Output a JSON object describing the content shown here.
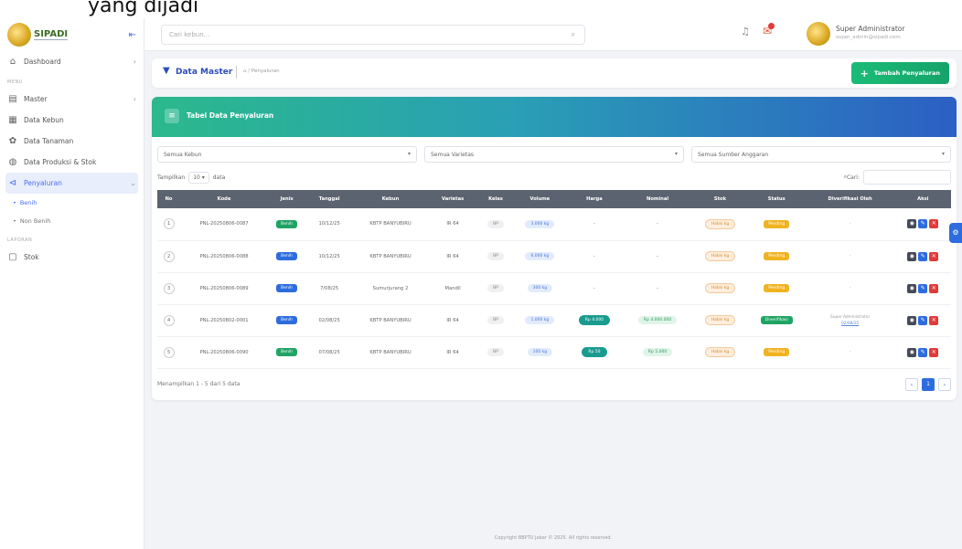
{
  "caption": "yang dijadi",
  "brand": {
    "name": "SIPADI",
    "toggle": "⇤"
  },
  "sidebar": {
    "items": [
      {
        "icon": "⌂",
        "label": "Dashboard",
        "chevron": "›"
      },
      {
        "section": "MENU"
      },
      {
        "icon": "▤",
        "label": "Master",
        "chevron": "›"
      },
      {
        "icon": "▦",
        "label": "Data Kebun"
      },
      {
        "icon": "✿",
        "label": "Data Tanaman"
      },
      {
        "icon": "◍",
        "label": "Data Produksi & Stok"
      },
      {
        "icon": "⊲",
        "label": "Penyaluran",
        "chevron": "⌄",
        "active": true
      }
    ],
    "subs": [
      "Benih",
      "Non Benih"
    ],
    "section2": "LAPORAN",
    "report": {
      "icon": "▢",
      "label": "Stok"
    }
  },
  "topbar": {
    "search_placeholder": "Cari kebun...",
    "user_name": "Super Administrator",
    "user_email": "super_admin@sipadi.com"
  },
  "page": {
    "title": "Data Master",
    "crumb": "⌂ / Penyaluran",
    "add_button": "Tambah Penyaluran"
  },
  "card": {
    "title": "Tabel Data Penyaluran",
    "filters": [
      "Semua Kebun",
      "Semua Varietas",
      "Semua Sumber Anggaran"
    ],
    "show_label": "Tampilkan",
    "show_value": "10",
    "data_label": "data",
    "search_label": "Cari:"
  },
  "table": {
    "headers": [
      "No",
      "Kode",
      "Jenis",
      "Tanggal",
      "Kebun",
      "Varietas",
      "Kelas",
      "Volume",
      "Harga",
      "Nominal",
      "Stok",
      "Status",
      "Diverifikasi Oleh",
      "Aksi"
    ],
    "rows": [
      {
        "no": "1",
        "kode": "PNL-20250806-0087",
        "jenis": "Benih",
        "jenis_color": "green",
        "tanggal": "10/12/25",
        "kebun": "KBTP BANYUBIRU",
        "varietas": "IR 64",
        "kelas": "BP",
        "volume": "3.000 kg",
        "harga": "-",
        "nominal": "-",
        "stok": "Habis kg",
        "status": "Pending",
        "ver_by": "-",
        "ver_link": ""
      },
      {
        "no": "2",
        "kode": "PNL-20250806-0088",
        "jenis": "Benih",
        "jenis_color": "blue",
        "tanggal": "10/12/25",
        "kebun": "KBTP BANYUBIRU",
        "varietas": "IR 64",
        "kelas": "BP",
        "volume": "6.000 kg",
        "harga": "-",
        "nominal": "-",
        "stok": "Habis kg",
        "status": "Pending",
        "ver_by": "-",
        "ver_link": ""
      },
      {
        "no": "3",
        "kode": "PNL-20250806-0089",
        "jenis": "Benih",
        "jenis_color": "blue",
        "tanggal": "7/08/25",
        "kebun": "Sumurjurang 2",
        "varietas": "Mandil",
        "kelas": "BP",
        "volume": "300 kg",
        "harga": "-",
        "nominal": "-",
        "stok": "Habis kg",
        "status": "Pending",
        "ver_by": "-",
        "ver_link": ""
      },
      {
        "no": "4",
        "kode": "PNL-20250802-0001",
        "jenis": "Benih",
        "jenis_color": "blue",
        "tanggal": "02/08/25",
        "kebun": "KBTP BANYUBIRU",
        "varietas": "IR 64",
        "kelas": "BP",
        "volume": "1.000 kg",
        "harga": "Rp 4.000",
        "nominal": "Rp 4.000.000",
        "stok": "Habis kg",
        "status": "Diverifikasi",
        "ver_by": "Super Administrator",
        "ver_link": "02/08/25"
      },
      {
        "no": "5",
        "kode": "PNL-20250806-0090",
        "jenis": "Benih",
        "jenis_color": "green",
        "tanggal": "07/08/25",
        "kebun": "KBTP BANYUBIRU",
        "varietas": "IR 64",
        "kelas": "BP",
        "volume": "100 kg",
        "harga": "Rp 50",
        "nominal": "Rp 5.000",
        "stok": "Habis kg",
        "status": "Pending",
        "ver_by": "-",
        "ver_link": ""
      }
    ]
  },
  "footer": {
    "info": "Menampilkan 1 - 5 dari 5 data",
    "prev": "‹",
    "page": "1",
    "next": "›"
  },
  "copyright": "Copyright BBPTU Jabar © 2025. All rights reserved.",
  "colors": {
    "accent": "#2d6cdf",
    "green": "#1fa463",
    "amber": "#f0b321",
    "danger": "#e23a3a"
  }
}
